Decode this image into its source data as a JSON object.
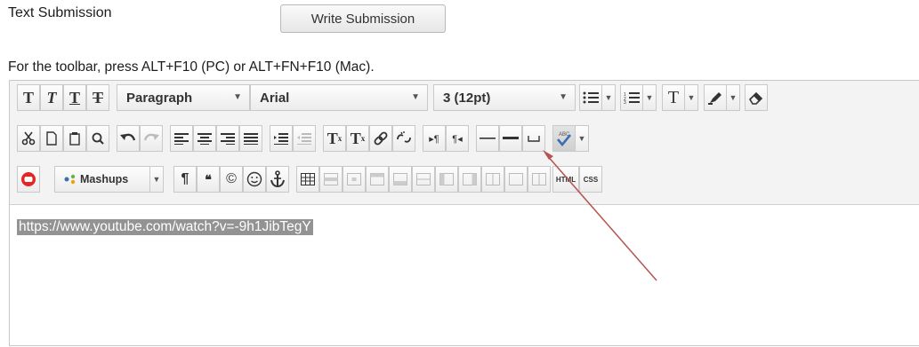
{
  "header": {
    "title": "Text Submission",
    "write_button": "Write Submission",
    "toolbar_hint": "For the toolbar, press ALT+F10 (PC) or ALT+FN+F10 (Mac)."
  },
  "toolbar": {
    "row1": {
      "format_buttons": [
        "T",
        "T",
        "T",
        "T"
      ],
      "paragraph_select": "Paragraph",
      "font_select": "Arial",
      "size_select": "3 (12pt)"
    },
    "row2": {
      "superscript": "T",
      "subscript": "T"
    },
    "row3": {
      "mashups_label": "Mashups",
      "html_label": "HTML",
      "css_label": "CSS"
    }
  },
  "editor": {
    "content_text": "https://www.youtube.com/watch?v=-9h1JibTegY"
  },
  "colors": {
    "selection_bg": "#939393",
    "annotation_arrow": "#b85450",
    "toolbar_bg": "#f3f3f3"
  }
}
